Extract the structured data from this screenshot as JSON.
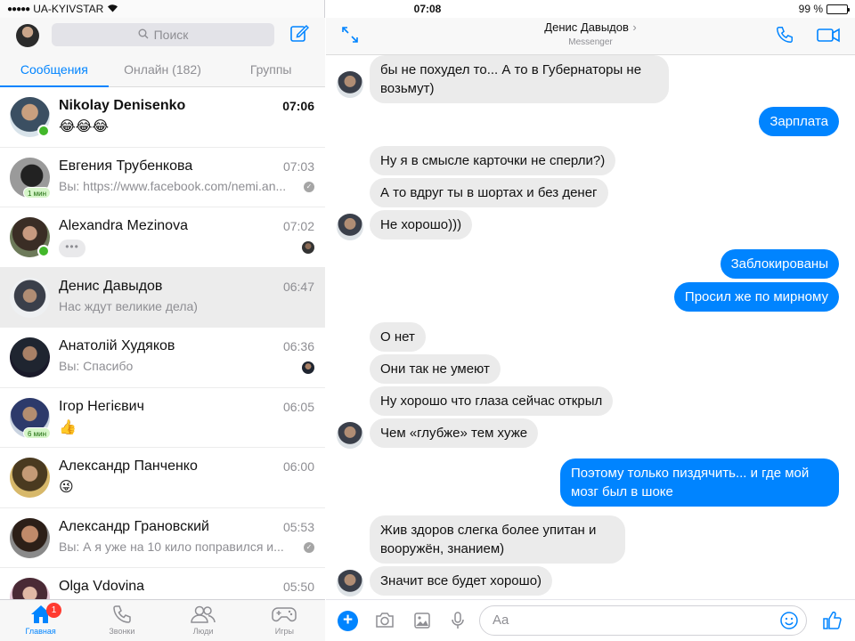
{
  "status_bar": {
    "carrier": "UA-KYIVSTAR",
    "time": "07:08",
    "battery": "99 %"
  },
  "sidebar": {
    "search_placeholder": "Поиск",
    "tabs": [
      {
        "label": "Сообщения"
      },
      {
        "label": "Онлайн (182)"
      },
      {
        "label": "Группы"
      }
    ],
    "conversations": [
      {
        "name": "Nikolay Denisenko",
        "time": "07:06",
        "preview": "",
        "emoji": "😂😂😂",
        "unread": true,
        "online": true
      },
      {
        "name": "Евгения Трубенкова",
        "time": "07:03",
        "preview": "Вы: https://www.facebook.com/nemi.an...",
        "badge": "1 мин"
      },
      {
        "name": "Alexandra Mezinova",
        "time": "07:02",
        "preview": "",
        "typing": "•••",
        "online": true
      },
      {
        "name": "Денис Давыдов",
        "time": "06:47",
        "preview": "Нас ждут великие дела)"
      },
      {
        "name": "Анатолій Худяков",
        "time": "06:36",
        "preview": "Вы: Спасибо"
      },
      {
        "name": "Ігор Негієвич",
        "time": "06:05",
        "preview": "",
        "emoji": "👍",
        "badge": "6 мин"
      },
      {
        "name": "Александр Панченко",
        "time": "06:00",
        "preview": "",
        "emoji": "😜"
      },
      {
        "name": "Александр Грановский",
        "time": "05:53",
        "preview": "Вы: А я уже на 10 кило поправился и..."
      },
      {
        "name": "Olga Vdovina",
        "time": "05:50",
        "preview": ""
      }
    ],
    "bottom_tabs": [
      {
        "label": "Главная",
        "badge": "1"
      },
      {
        "label": "Звонки"
      },
      {
        "label": "Люди"
      },
      {
        "label": "Игры"
      }
    ]
  },
  "chat": {
    "contact_name": "Денис Давыдов",
    "contact_chevron": "›",
    "subtitle": "Messenger",
    "messages": [
      {
        "dir": "in",
        "lines": [
          "бы не похудел то... А то в Губернаторы не",
          "возьмут)"
        ]
      },
      {
        "dir": "out",
        "lines": [
          "Зарплата"
        ]
      },
      {
        "dir": "in",
        "lines": [
          "Ну я в смысле карточки не сперли?)"
        ]
      },
      {
        "dir": "in",
        "lines": [
          "А то вдруг ты в шортах и без денег"
        ]
      },
      {
        "dir": "in",
        "lines": [
          "Не хорошо)))"
        ]
      },
      {
        "dir": "out",
        "lines": [
          "Заблокированы"
        ]
      },
      {
        "dir": "out",
        "lines": [
          "Просил же по мирному"
        ]
      },
      {
        "dir": "in",
        "lines": [
          "О нет"
        ]
      },
      {
        "dir": "in",
        "lines": [
          "Они так не умеют"
        ]
      },
      {
        "dir": "in",
        "lines": [
          "Ну хорошо что глаза сейчас открыл"
        ]
      },
      {
        "dir": "in",
        "lines": [
          "Чем «глубже» тем хуже"
        ]
      },
      {
        "dir": "out",
        "lines": [
          "Поэтому только пиздячить... и где мой",
          "мозг был в шоке"
        ]
      },
      {
        "dir": "in",
        "lines": [
          "Жив здоров слегка более упитан и",
          "вооружён, знанием)"
        ]
      },
      {
        "dir": "in",
        "lines": [
          "Значит все будет хорошо)"
        ]
      }
    ],
    "composer_placeholder": "Aa"
  },
  "colors": {
    "accent": "#0084ff",
    "online": "#42b72a",
    "badge": "#ff3b30"
  },
  "icons": [
    "wifi-icon",
    "battery-icon",
    "search-icon",
    "compose-icon",
    "expand-icon",
    "phone-icon",
    "video-icon",
    "plus-icon",
    "camera-icon",
    "image-icon",
    "mic-icon",
    "smile-icon",
    "like-icon",
    "home-icon",
    "calls-icon",
    "people-icon",
    "games-icon"
  ]
}
